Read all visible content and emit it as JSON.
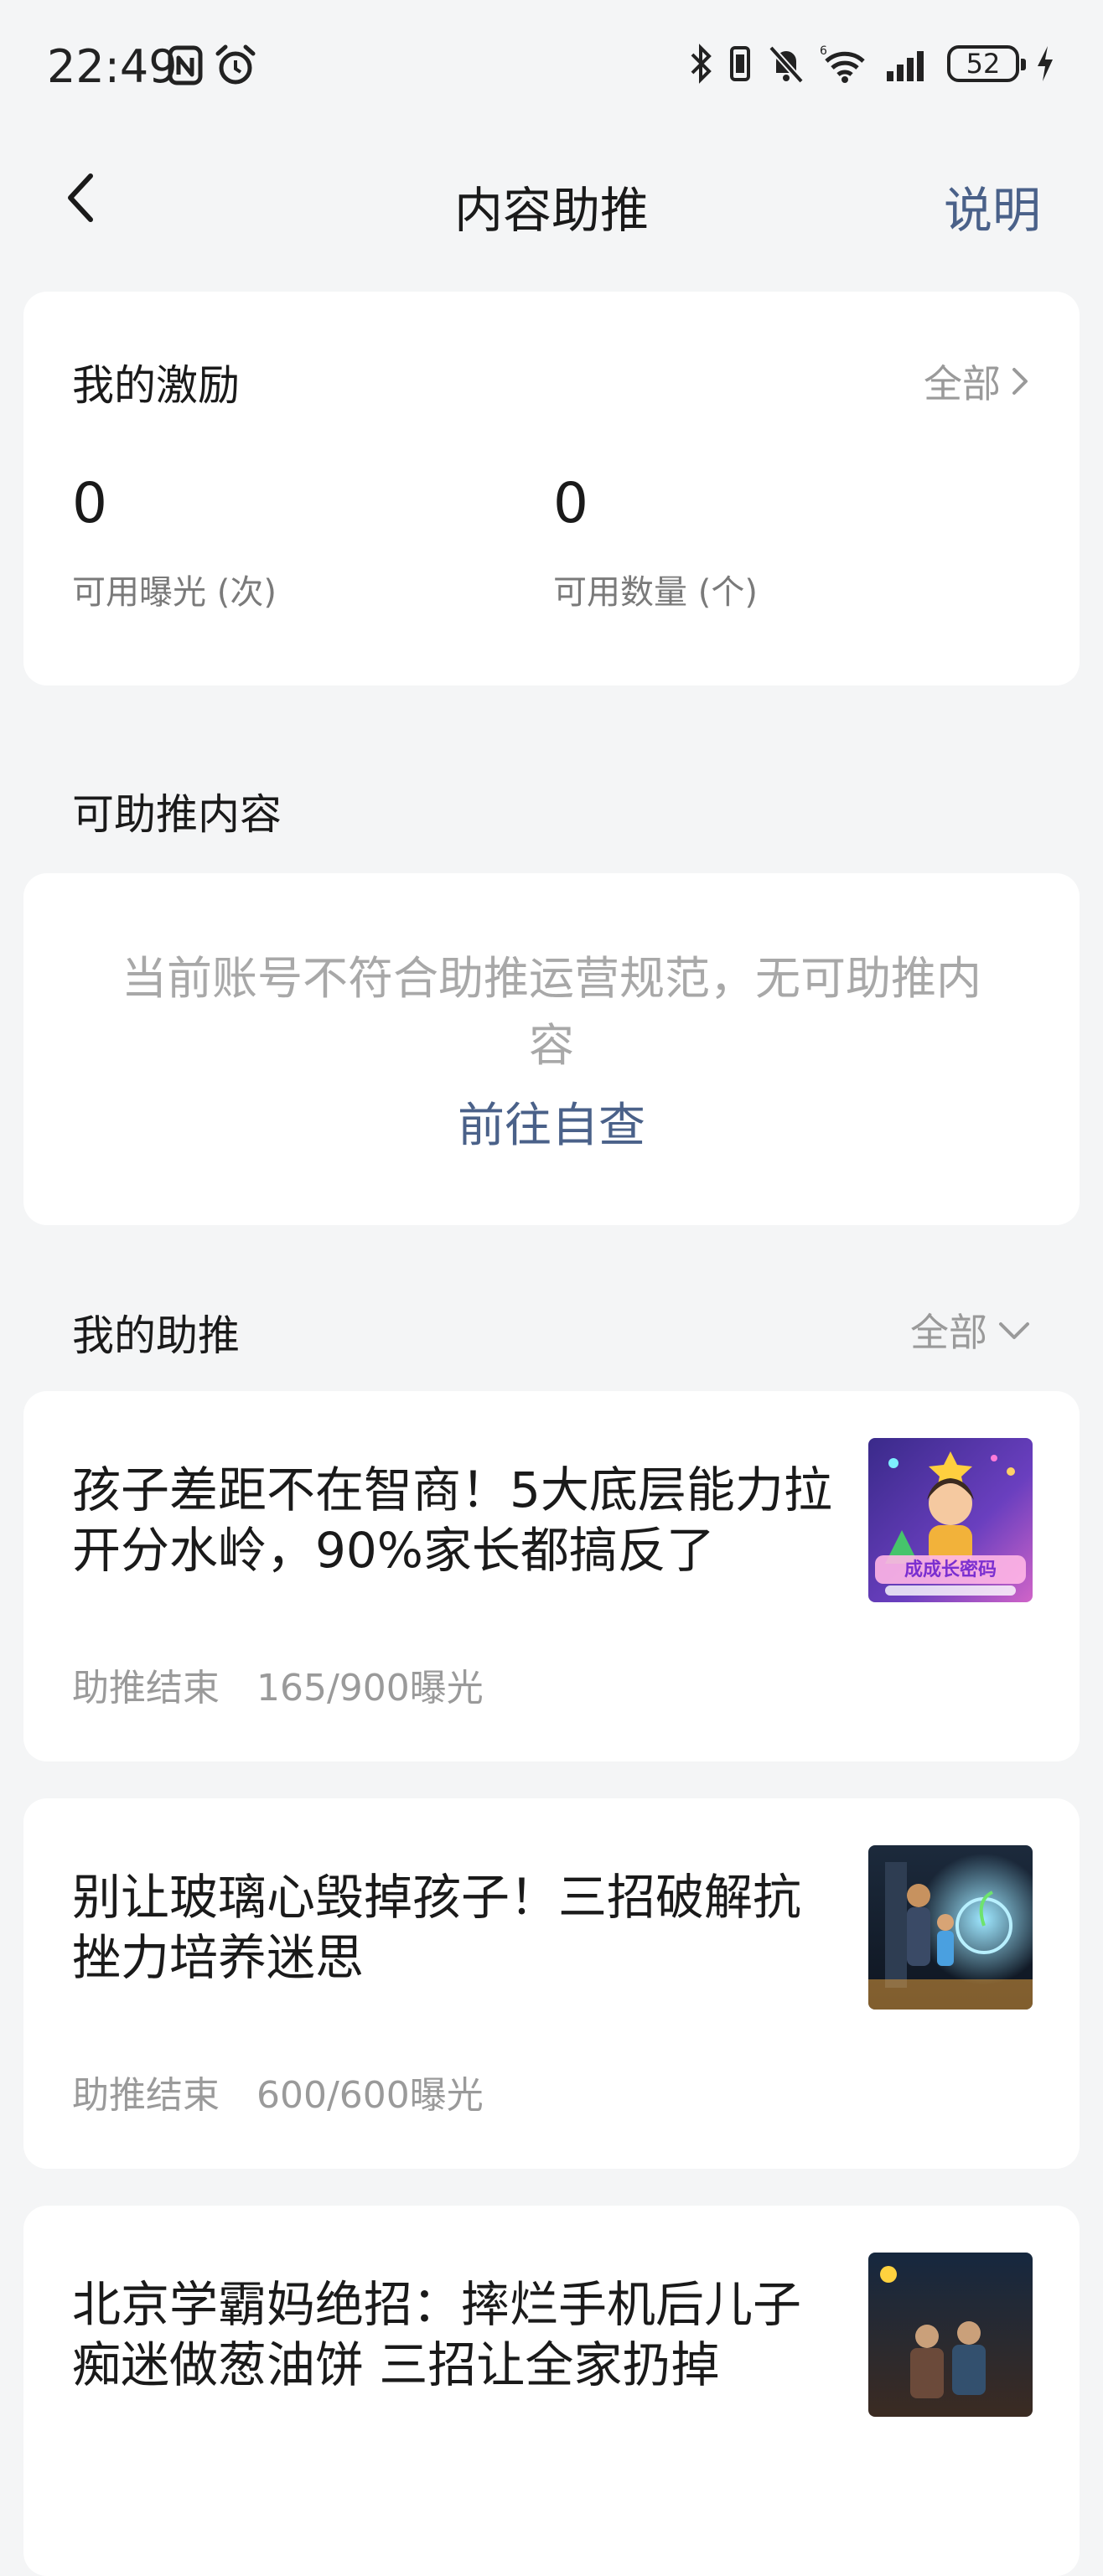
{
  "status_bar": {
    "time": "22:49",
    "battery": "52",
    "icons": [
      "nfc-icon",
      "alarm-icon",
      "bluetooth-icon",
      "vibrate-icon",
      "mute-icon",
      "wifi-icon",
      "signal-icon",
      "charging-icon"
    ]
  },
  "nav": {
    "title": "内容助推",
    "help_label": "说明"
  },
  "incentive": {
    "title": "我的激励",
    "all_label": "全部",
    "stats": [
      {
        "value": "0",
        "label": "可用曝光 (次)"
      },
      {
        "value": "0",
        "label": "可用数量 (个)"
      }
    ]
  },
  "boostable": {
    "title": "可助推内容",
    "notice": "当前账号不符合助推运营规范，无可助推内容",
    "action_label": "前往自查"
  },
  "my_boosts": {
    "title": "我的助推",
    "filter_label": "全部",
    "items": [
      {
        "title": "孩子差距不在智商！5大底层能力拉开分水岭，90%家长都搞反了",
        "status": "助推结束",
        "progress": "165/900曝光",
        "thumb_label": "成成长密码"
      },
      {
        "title": "别让玻璃心毁掉孩子！三招破解抗挫力培养迷思",
        "status": "助推结束",
        "progress": "600/600曝光"
      },
      {
        "title": "北京学霸妈绝招：摔烂手机后儿子痴迷做葱油饼 三招让全家扔掉",
        "status": "",
        "progress": ""
      }
    ]
  },
  "colors": {
    "background": "#f4f5f6",
    "card": "#ffffff",
    "accent": "#4a6189",
    "muted": "#9a9a9a"
  }
}
